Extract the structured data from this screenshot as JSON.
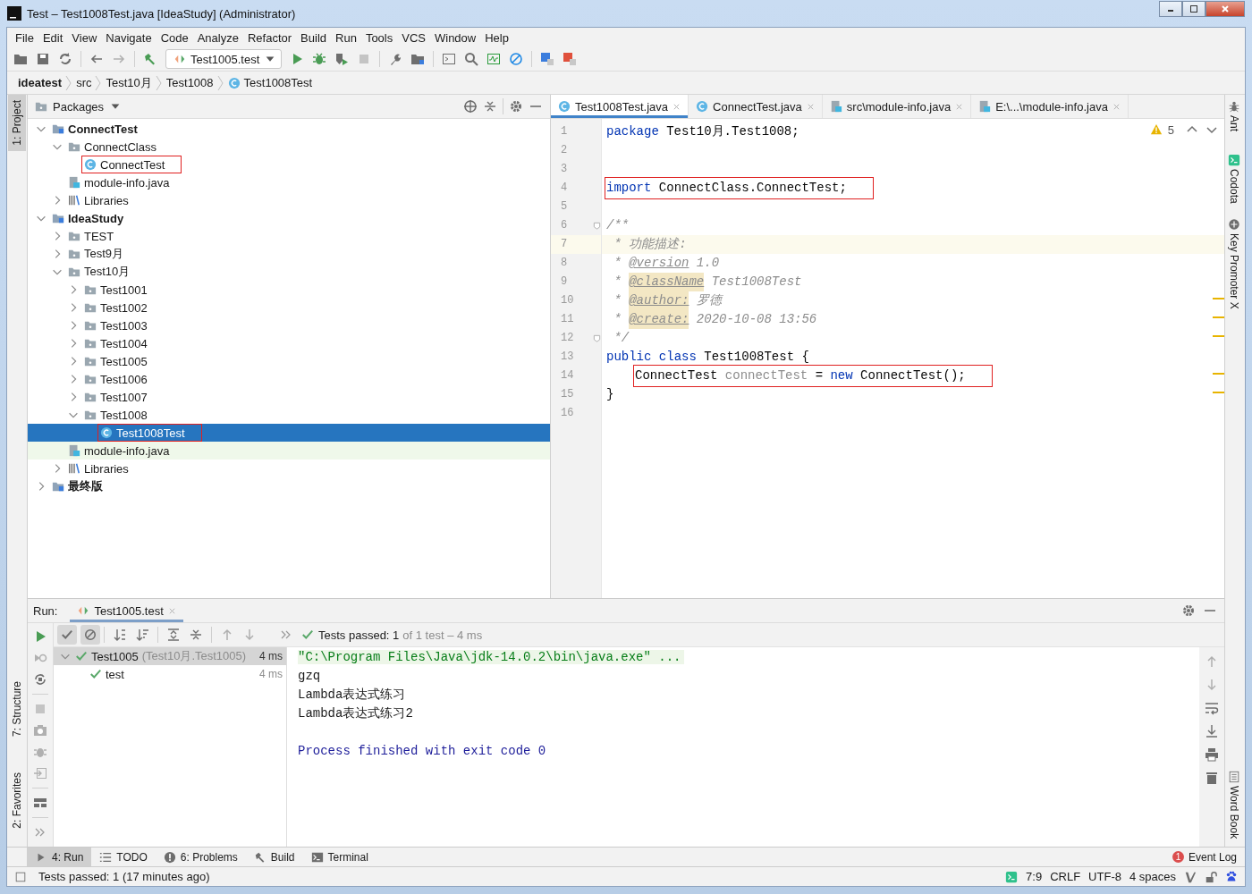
{
  "window": {
    "title": "Test – Test1008Test.java [IdeaStudy] (Administrator)"
  },
  "menu": [
    "File",
    "Edit",
    "View",
    "Navigate",
    "Code",
    "Analyze",
    "Refactor",
    "Build",
    "Run",
    "Tools",
    "VCS",
    "Window",
    "Help"
  ],
  "toolbar": {
    "run_config": "Test1005.test"
  },
  "breadcrumbs": [
    {
      "label": "ideatest",
      "kind": "root"
    },
    {
      "label": "src",
      "kind": "dir"
    },
    {
      "label": "Test10月",
      "kind": "dir"
    },
    {
      "label": "Test1008",
      "kind": "dir"
    },
    {
      "label": "Test1008Test",
      "kind": "class"
    }
  ],
  "left_tool_tabs": [
    {
      "label": "1: Project",
      "selected": true
    },
    {
      "label": "7: Structure",
      "selected": false
    },
    {
      "label": "2: Favorites",
      "selected": false
    }
  ],
  "right_tool_tabs": [
    {
      "label": "Ant",
      "kind": "ant"
    },
    {
      "label": "Codota",
      "kind": "codota"
    },
    {
      "label": "Key Promoter X",
      "kind": "key"
    },
    {
      "label": "Word Book",
      "kind": "book"
    }
  ],
  "project": {
    "view": "Packages",
    "tree": [
      {
        "label": "ConnectTest",
        "kind": "module",
        "expanded": true,
        "selected": false,
        "annotated": false,
        "highlighted": false,
        "children": [
          {
            "label": "ConnectClass",
            "kind": "package",
            "expanded": true,
            "selected": false,
            "annotated": false,
            "highlighted": false,
            "children": [
              {
                "label": "ConnectTest",
                "kind": "class",
                "selected": false,
                "annotated": true,
                "highlighted": false
              }
            ]
          },
          {
            "label": "module-info.java",
            "kind": "file",
            "selected": false,
            "annotated": false,
            "highlighted": false
          },
          {
            "label": "Libraries",
            "kind": "library",
            "expanded": false,
            "selected": false,
            "annotated": false,
            "highlighted": false
          }
        ]
      },
      {
        "label": "IdeaStudy",
        "kind": "module",
        "expanded": true,
        "selected": false,
        "annotated": false,
        "highlighted": false,
        "children": [
          {
            "label": "TEST",
            "kind": "package",
            "expanded": false,
            "selected": false,
            "annotated": false,
            "highlighted": false
          },
          {
            "label": "Test9月",
            "kind": "package",
            "expanded": false,
            "selected": false,
            "annotated": false,
            "highlighted": false
          },
          {
            "label": "Test10月",
            "kind": "package",
            "expanded": true,
            "selected": false,
            "annotated": false,
            "highlighted": false,
            "children": [
              {
                "label": "Test1001",
                "kind": "package",
                "expanded": false,
                "selected": false,
                "annotated": false,
                "highlighted": false
              },
              {
                "label": "Test1002",
                "kind": "package",
                "expanded": false,
                "selected": false,
                "annotated": false,
                "highlighted": false
              },
              {
                "label": "Test1003",
                "kind": "package",
                "expanded": false,
                "selected": false,
                "annotated": false,
                "highlighted": false
              },
              {
                "label": "Test1004",
                "kind": "package",
                "expanded": false,
                "selected": false,
                "annotated": false,
                "highlighted": false
              },
              {
                "label": "Test1005",
                "kind": "package",
                "expanded": false,
                "selected": false,
                "annotated": false,
                "highlighted": false
              },
              {
                "label": "Test1006",
                "kind": "package",
                "expanded": false,
                "selected": false,
                "annotated": false,
                "highlighted": false
              },
              {
                "label": "Test1007",
                "kind": "package",
                "expanded": false,
                "selected": false,
                "annotated": false,
                "highlighted": false
              },
              {
                "label": "Test1008",
                "kind": "package",
                "expanded": true,
                "selected": false,
                "annotated": false,
                "highlighted": false,
                "children": [
                  {
                    "label": "Test1008Test",
                    "kind": "class",
                    "selected": true,
                    "annotated": true,
                    "highlighted": false
                  }
                ]
              }
            ]
          },
          {
            "label": "module-info.java",
            "kind": "file",
            "selected": false,
            "annotated": false,
            "highlighted": true
          },
          {
            "label": "Libraries",
            "kind": "library",
            "expanded": false,
            "selected": false,
            "annotated": false,
            "highlighted": false
          }
        ]
      },
      {
        "label": "最终版",
        "kind": "module",
        "expanded": false,
        "selected": false,
        "annotated": false,
        "highlighted": false
      }
    ]
  },
  "editor": {
    "tabs": [
      {
        "label": "Test1008Test.java",
        "kind": "class",
        "selected": true
      },
      {
        "label": "ConnectTest.java",
        "kind": "class",
        "selected": false
      },
      {
        "label": "src\\module-info.java",
        "kind": "file",
        "selected": false
      },
      {
        "label": "E:\\...\\module-info.java",
        "kind": "file",
        "selected": false
      }
    ],
    "warnings": "5",
    "lines": [
      {
        "n": "1",
        "current": false,
        "annotated": false,
        "fold": false,
        "indented": false,
        "tokens": [
          {
            "text": "package",
            "kind": "kw"
          },
          {
            "text": " Test10月.Test1008;",
            "kind": "text"
          }
        ]
      },
      {
        "n": "2",
        "current": false,
        "fold": false
      },
      {
        "n": "3",
        "current": false,
        "fold": false
      },
      {
        "n": "4",
        "current": false,
        "annotated": true,
        "fold": false,
        "indented": false,
        "tokens": [
          {
            "text": "import",
            "kind": "kw"
          },
          {
            "text": " ConnectClass.ConnectTest;",
            "kind": "text"
          }
        ]
      },
      {
        "n": "5",
        "current": false,
        "fold": false
      },
      {
        "n": "6",
        "current": false,
        "annotated": false,
        "fold": true,
        "indented": false,
        "tokens": [
          {
            "text": "/**",
            "kind": "comment"
          }
        ]
      },
      {
        "n": "7",
        "current": true,
        "annotated": false,
        "fold": false,
        "indented": false,
        "tokens": [
          {
            "text": " * 功能描述:",
            "kind": "comment"
          }
        ]
      },
      {
        "n": "8",
        "current": false,
        "annotated": false,
        "fold": false,
        "indented": false,
        "tokens": [
          {
            "text": " * ",
            "kind": "comment"
          },
          {
            "text": "@version",
            "kind": "tag"
          },
          {
            "text": " 1.0",
            "kind": "comment"
          }
        ]
      },
      {
        "n": "9",
        "current": false,
        "annotated": false,
        "fold": false,
        "indented": false,
        "tokens": [
          {
            "text": " * ",
            "kind": "comment"
          },
          {
            "text": "@className",
            "kind": "tag_marked"
          },
          {
            "text": " Test1008Test",
            "kind": "comment"
          }
        ]
      },
      {
        "n": "10",
        "current": false,
        "annotated": false,
        "fold": false,
        "indented": false,
        "tokens": [
          {
            "text": " * ",
            "kind": "comment"
          },
          {
            "text": "@author:",
            "kind": "tag_marked"
          },
          {
            "text": " 罗德",
            "kind": "comment"
          }
        ]
      },
      {
        "n": "11",
        "current": false,
        "annotated": false,
        "fold": false,
        "indented": false,
        "tokens": [
          {
            "text": " * ",
            "kind": "comment"
          },
          {
            "text": "@create:",
            "kind": "tag_marked"
          },
          {
            "text": " 2020-10-08 13:56",
            "kind": "comment"
          }
        ]
      },
      {
        "n": "12",
        "current": false,
        "annotated": false,
        "fold": true,
        "indented": false,
        "tokens": [
          {
            "text": " */",
            "kind": "comment"
          }
        ]
      },
      {
        "n": "13",
        "current": false,
        "annotated": false,
        "fold": false,
        "indented": false,
        "tokens": [
          {
            "text": "public",
            "kind": "kw"
          },
          {
            "text": " class",
            "kind": "kw"
          },
          {
            "text": " Test1008Test {",
            "kind": "text"
          }
        ]
      },
      {
        "n": "14",
        "current": false,
        "annotated": true,
        "fold": false,
        "indented": true,
        "tokens": [
          {
            "text": "ConnectTest ",
            "kind": "text"
          },
          {
            "text": "connectTest",
            "kind": "unused"
          },
          {
            "text": " = ",
            "kind": "text"
          },
          {
            "text": "new",
            "kind": "kw"
          },
          {
            "text": " ConnectTest();",
            "kind": "text"
          }
        ]
      },
      {
        "n": "15",
        "current": false,
        "annotated": false,
        "fold": false,
        "indented": false,
        "tokens": [
          {
            "text": "}",
            "kind": "text"
          }
        ]
      },
      {
        "n": "16",
        "current": false,
        "fold": false
      }
    ]
  },
  "run": {
    "label": "Run:",
    "tab": "Test1005.test",
    "status_main": "Tests passed: 1",
    "status_rest": "of 1 test – 4 ms",
    "tests": [
      {
        "name": "Test1005",
        "detail": "(Test10月.Test1005)",
        "time": "4 ms",
        "kind": "suite",
        "selected": true,
        "expanded": true
      },
      {
        "name": "test",
        "time": "4 ms",
        "kind": "case",
        "selected": false
      }
    ],
    "console": [
      {
        "text": "\"C:\\Program Files\\Java\\jdk-14.0.2\\bin\\java.exe\" ...",
        "kind": "command"
      },
      {
        "text": "gzq",
        "kind": "output"
      },
      {
        "text": "Lambda表达式练习",
        "kind": "output"
      },
      {
        "text": "Lambda表达式练习2",
        "kind": "output"
      },
      {
        "text": "Process finished with exit code 0",
        "kind": "exit"
      }
    ]
  },
  "bottom_tabs": [
    {
      "label": "4: Run",
      "kind": "run",
      "selected": true
    },
    {
      "label": "TODO",
      "kind": "todo",
      "selected": false
    },
    {
      "label": "6: Problems",
      "kind": "problems",
      "selected": false
    },
    {
      "label": "Build",
      "kind": "build",
      "selected": false
    },
    {
      "label": "Terminal",
      "kind": "terminal",
      "selected": false
    }
  ],
  "event_log": {
    "label": "Event Log",
    "count": "1"
  },
  "status_bar": {
    "message": "Tests passed: 1 (17 minutes ago)",
    "items": [
      "7:9",
      "CRLF",
      "UTF-8",
      "4 spaces"
    ]
  }
}
